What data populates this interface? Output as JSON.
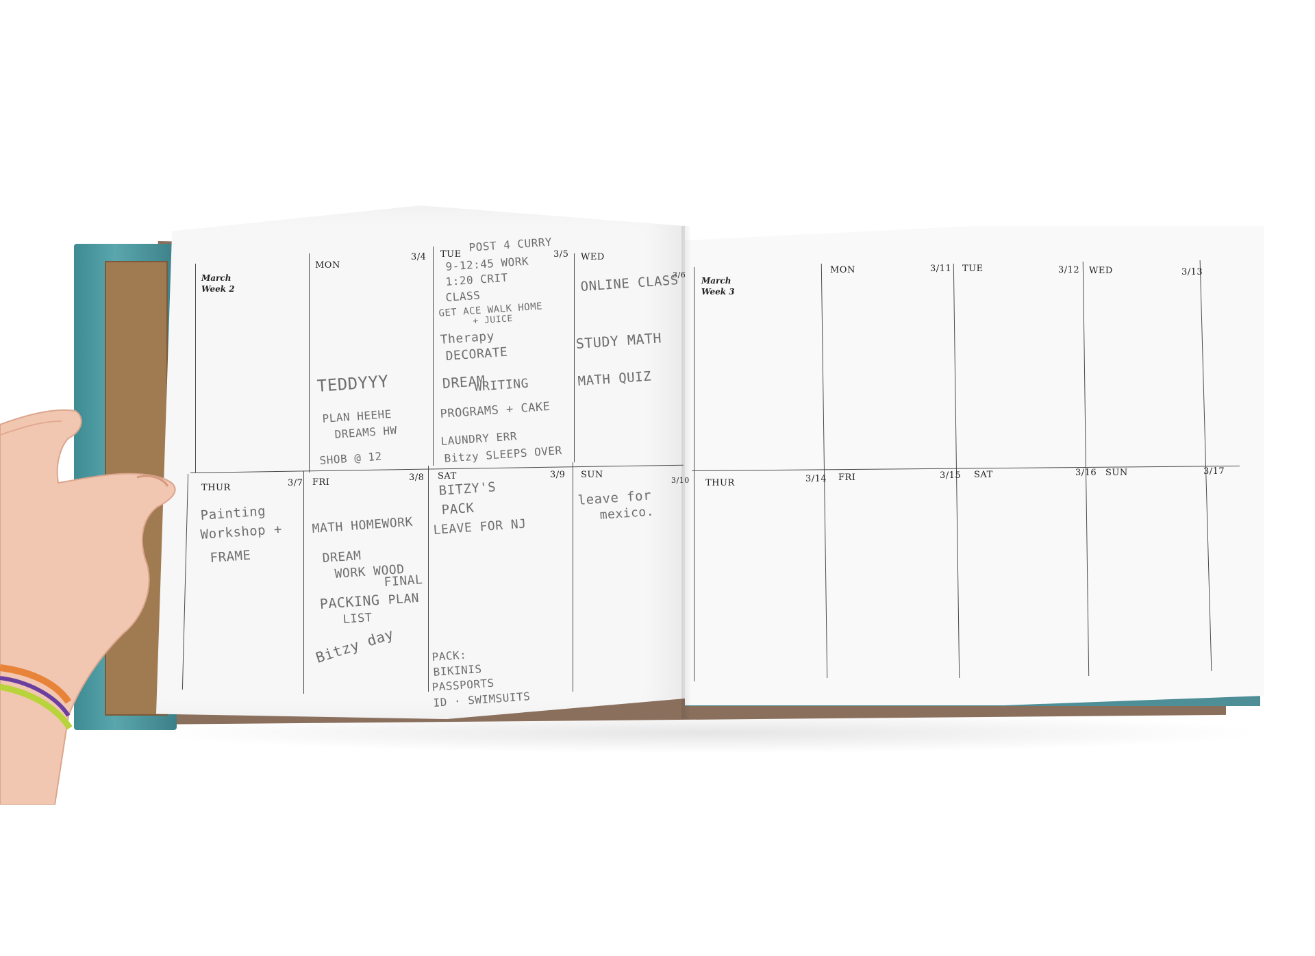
{
  "planner": {
    "left_page": {
      "week_label": {
        "month": "March",
        "week": "Week 2"
      },
      "days": [
        {
          "day": "MON",
          "date": "3/4"
        },
        {
          "day": "TUE",
          "date": "3/5"
        },
        {
          "day": "WED",
          "date": "3/6"
        },
        {
          "day": "THUR",
          "date": "3/7"
        },
        {
          "day": "FRI",
          "date": "3/8"
        },
        {
          "day": "SAT",
          "date": "3/9"
        },
        {
          "day": "SUN",
          "date": "3/10"
        }
      ]
    },
    "right_page": {
      "week_label": {
        "month": "March",
        "week": "Week 3"
      },
      "days": [
        {
          "day": "MON",
          "date": "3/11"
        },
        {
          "day": "TUE",
          "date": "3/12"
        },
        {
          "day": "WED",
          "date": "3/13"
        },
        {
          "day": "THUR",
          "date": "3/14"
        },
        {
          "day": "FRI",
          "date": "3/15"
        },
        {
          "day": "SAT",
          "date": "3/16"
        },
        {
          "day": "SUN",
          "date": "3/17"
        }
      ]
    },
    "handwriting": {
      "mon": [
        "TEDDYYY",
        "PLAN HEEHE",
        "DREAMS HW",
        "SHOB @ 12"
      ],
      "tue": [
        "POST 4 CURRY",
        "9-12:45 WORK",
        "1:20 CRIT",
        "CLASS",
        "GET ACE WALK HOME",
        "+ JUICE",
        "Therapy",
        "DECORATE",
        "DREAM",
        "WRITING",
        "PROGRAMS + CAKE",
        "LAUNDRY ERR",
        "Bitzy SLEEPS OVER"
      ],
      "wed": [
        "ONLINE CLASS",
        "STUDY MATH",
        "MATH QUIZ"
      ],
      "thur": [
        "Painting",
        "Workshop +",
        "FRAME"
      ],
      "fri": [
        "MATH HOMEWORK",
        "DREAM",
        "WORK WOOD",
        "PACKING",
        "LIST",
        "FINAL",
        "PLAN",
        "Bitzy day"
      ],
      "sat": [
        "BITZY'S",
        "PACK",
        "LEAVE FOR NJ",
        "PACK:",
        "BIKINIS",
        "PASSPORTS",
        "ID · SWIMSUITS"
      ],
      "sun": [
        "leave for",
        "mexico."
      ]
    }
  }
}
